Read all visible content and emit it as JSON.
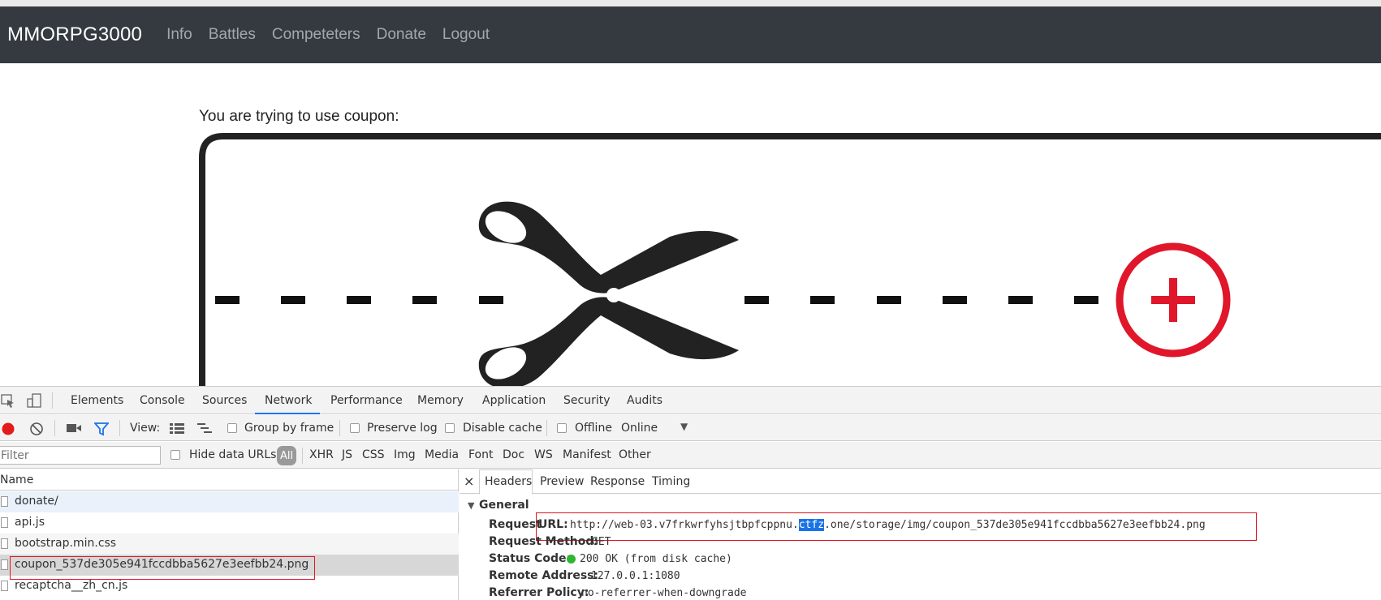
{
  "site": {
    "brand": "MMORPG3000",
    "nav": [
      "Info",
      "Battles",
      "Competeters",
      "Donate",
      "Logout"
    ],
    "coupon_prompt": "You are trying to use coupon:"
  },
  "colors": {
    "navbar": "#343a40",
    "coupon_red": "#e0162b",
    "devtools_accent": "#1a73e8",
    "highlight_box": "#e0161e"
  },
  "devtools": {
    "tabs": [
      "Elements",
      "Console",
      "Sources",
      "Network",
      "Performance",
      "Memory",
      "Application",
      "Security",
      "Audits"
    ],
    "active_tab": "Network",
    "toolbar": {
      "view_label": "View:",
      "group_by_frame": "Group by frame",
      "preserve_log": "Preserve log",
      "disable_cache": "Disable cache",
      "offline": "Offline",
      "throttle": "Online"
    },
    "filterbar": {
      "placeholder": "Filter",
      "hide_data_urls": "Hide data URLs",
      "types": [
        "All",
        "XHR",
        "JS",
        "CSS",
        "Img",
        "Media",
        "Font",
        "Doc",
        "WS",
        "Manifest",
        "Other"
      ]
    },
    "requests": {
      "column": "Name",
      "rows": [
        "donate/",
        "api.js",
        "bootstrap.min.css",
        "coupon_537de305e941fccdbba5627e3eefbb24.png",
        "recaptcha__zh_cn.js"
      ],
      "selected": "coupon_537de305e941fccdbba5627e3eefbb24.png"
    },
    "details": {
      "close": "×",
      "tabs": [
        "Headers",
        "Preview",
        "Response",
        "Timing"
      ],
      "section": "General",
      "request_url_key_a": "Request",
      "request_url_key_b": "URL:",
      "url_before": "http://web-03.v7frkwrfyhsjtbpfcppnu.",
      "url_selected": "ctfz",
      "url_after": ".one/storage/img/coupon_537de305e941fccdbba5627e3eefbb24.png",
      "method_key": "Request Method:",
      "method_val": "GET",
      "status_key": "Status Code:",
      "status_val": "200 OK (from disk cache)",
      "status_color": "#2fb52f",
      "remote_key": "Remote Address:",
      "remote_val": "127.0.0.1:1080",
      "referrer_key": "Referrer Policy:",
      "referrer_val": "no-referrer-when-downgrade"
    }
  }
}
